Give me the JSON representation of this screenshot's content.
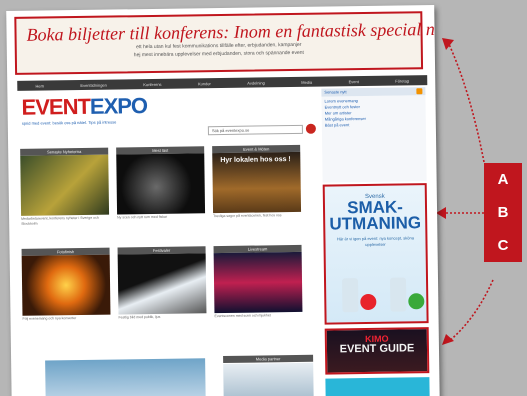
{
  "banner": {
    "headline": "Boka biljetter till konferens: Inom en fantastisk special nu!",
    "line1": "ett hela utan kul fest kommunikations tillfälle efter, erbjudanden, kampanjer",
    "line2": "hej mest innebära upplevelser med erbjudanden, stora och spännande event"
  },
  "nav": [
    "Hem",
    "Eventtidningen",
    "Konferens",
    "Kunder",
    "Avdelning",
    "Media",
    "Event",
    "Företag"
  ],
  "logo": {
    "part1": "EVENT",
    "part2": "EXPO"
  },
  "tagline": "sprid med event: besök oss på nätet. Tips på intresse",
  "search_placeholder": "Sök på eventexpo.se",
  "cards": [
    {
      "header": "Senaste Nyheterna",
      "caption": "Medarbetarevent, konferens nyheter i Sverige och Stockholm"
    },
    {
      "header": "Mest läst",
      "caption": "Ny scen och nytt rum med fiskar"
    },
    {
      "header": "Event & Möten",
      "caption": "Trevliga sagor på eventscenen, fest hos oss"
    },
    {
      "header": "Fotofinish",
      "caption": "Följ evenemang och nya konserter"
    },
    {
      "header": "Festivaler",
      "caption": "Festlig bild med publik, ljus"
    },
    {
      "header": "Livestream",
      "caption": "Eventscenen med scen och mjukhet"
    }
  ],
  "card_overlay": "Hyr lokalen hos oss !",
  "sidebar": {
    "header": "Senaste nytt",
    "items": [
      "Lorem evenemang",
      "Eventnytt och fester",
      "Mer om artister",
      "Mångåriga konferenser",
      "Bäst på event"
    ]
  },
  "smak": {
    "pre": "Svensk",
    "title": "SMAK-UTMANING",
    "body": "Här är vi igen på event: nya koncept, sköna upplevelser"
  },
  "kimo": {
    "brand": "KIMO",
    "title": "EVENT GUIDE"
  },
  "bottom_header": "Media partner",
  "labels": [
    "A",
    "B",
    "C"
  ],
  "colors": {
    "accent": "#c0161e",
    "brand_blue": "#1f5fb0",
    "nav_bg": "#3a3a3a"
  }
}
